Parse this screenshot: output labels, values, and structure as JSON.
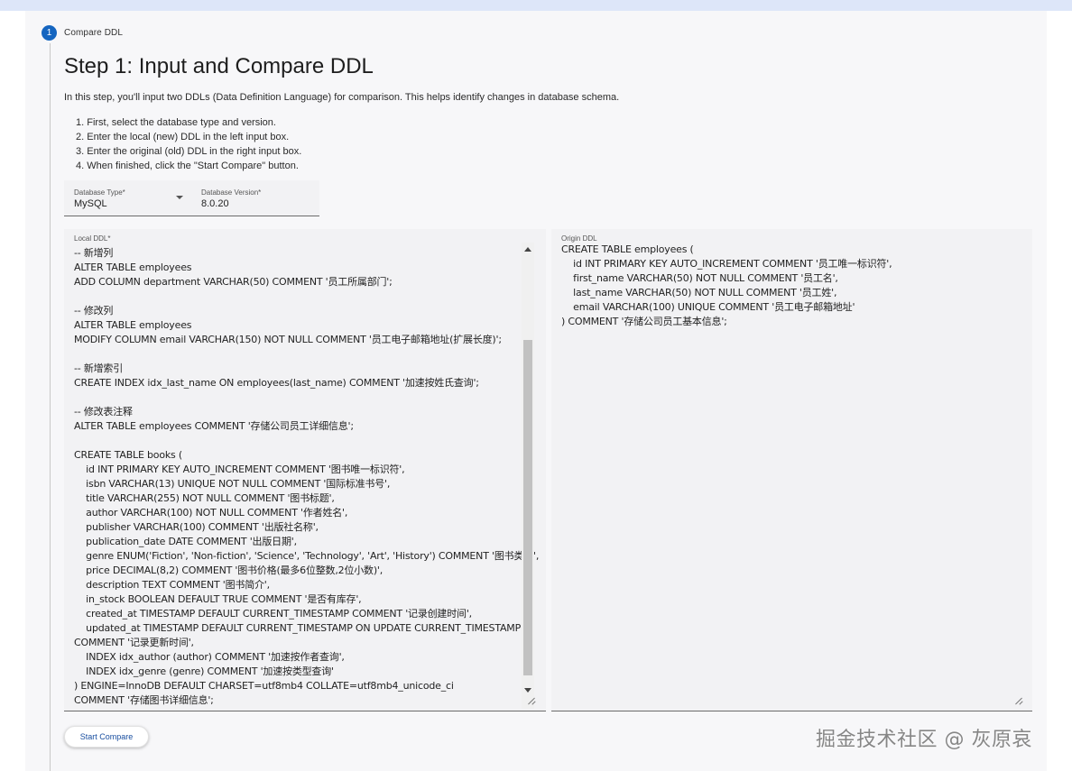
{
  "stepper": {
    "number": "1",
    "label": "Compare DDL"
  },
  "page": {
    "title": "Step 1: Input and Compare DDL",
    "intro": "In this step, you'll input two DDLs (Data Definition Language) for comparison. This helps identify changes in database schema.",
    "steps": [
      "1. First, select the database type and version.",
      "2. Enter the local (new) DDL in the left input box.",
      "3. Enter the original (old) DDL in the right input box.",
      "4. When finished, click the \"Start Compare\" button."
    ]
  },
  "fields": {
    "db_type_label": "Database Type*",
    "db_type_value": "MySQL",
    "db_version_label": "Database Version*",
    "db_version_value": "8.0.20"
  },
  "local_ddl": {
    "label": "Local DDL*",
    "lines": [
      "-- 新增列",
      "ALTER TABLE employees",
      "ADD COLUMN department VARCHAR(50) COMMENT '员工所属部门';",
      "",
      "-- 修改列",
      "ALTER TABLE employees",
      "MODIFY COLUMN email VARCHAR(150) NOT NULL COMMENT '员工电子邮箱地址(扩展长度)';",
      "",
      "-- 新增索引",
      "CREATE INDEX idx_last_name ON employees(last_name) COMMENT '加速按姓氏查询';",
      "",
      "-- 修改表注释",
      "ALTER TABLE employees COMMENT '存储公司员工详细信息';",
      "",
      "CREATE TABLE books (",
      "    id INT PRIMARY KEY AUTO_INCREMENT COMMENT '图书唯一标识符',",
      "    isbn VARCHAR(13) UNIQUE NOT NULL COMMENT '国际标准书号',",
      "    title VARCHAR(255) NOT NULL COMMENT '图书标题',",
      "    author VARCHAR(100) NOT NULL COMMENT '作者姓名',",
      "    publisher VARCHAR(100) COMMENT '出版社名称',",
      "    publication_date DATE COMMENT '出版日期',",
      "    genre ENUM('Fiction', 'Non-fiction', 'Science', 'Technology', 'Art', 'History') COMMENT '图书类型',",
      "    price DECIMAL(8,2) COMMENT '图书价格(最多6位整数,2位小数)',",
      "    description TEXT COMMENT '图书简介',",
      "    in_stock BOOLEAN DEFAULT TRUE COMMENT '是否有库存',",
      "    created_at TIMESTAMP DEFAULT CURRENT_TIMESTAMP COMMENT '记录创建时间',",
      "    updated_at TIMESTAMP DEFAULT CURRENT_TIMESTAMP ON UPDATE CURRENT_TIMESTAMP",
      "COMMENT '记录更新时间',",
      "    INDEX idx_author (author) COMMENT '加速按作者查询',",
      "    INDEX idx_genre (genre) COMMENT '加速按类型查询'",
      ") ENGINE=InnoDB DEFAULT CHARSET=utf8mb4 COLLATE=utf8mb4_unicode_ci",
      "COMMENT '存储图书详细信息';"
    ]
  },
  "origin_ddl": {
    "label": "Origin DDL",
    "lines": [
      "CREATE TABLE employees (",
      "    id INT PRIMARY KEY AUTO_INCREMENT COMMENT '员工唯一标识符',",
      "    first_name VARCHAR(50) NOT NULL COMMENT '员工名',",
      "    last_name VARCHAR(50) NOT NULL COMMENT '员工姓',",
      "    email VARCHAR(100) UNIQUE COMMENT '员工电子邮箱地址'",
      ") COMMENT '存储公司员工基本信息';"
    ]
  },
  "actions": {
    "start_compare": "Start Compare"
  },
  "watermark": "掘金技术社区 @ 灰原哀"
}
